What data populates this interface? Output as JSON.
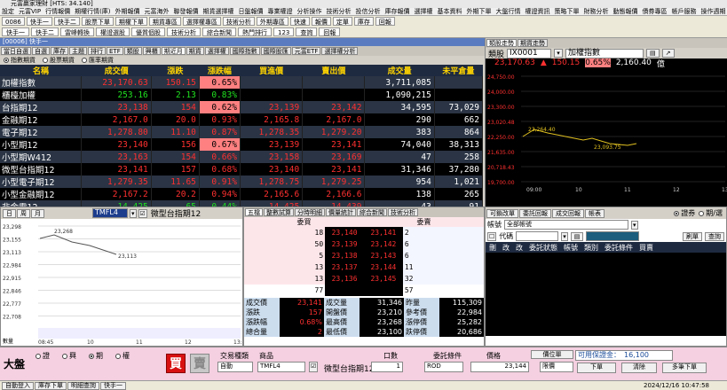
{
  "app": {
    "title": "元富贏家理財 [HTS: 34.140]",
    "window_sub": "[00006] 快手一"
  },
  "menu": [
    "設定",
    "元富VIP",
    "行情報價",
    "期權行情(庫)",
    "外期報價",
    "元富海外",
    "聯發報價",
    "期貨選擇權",
    "日盤報價",
    "專業權證",
    "分析操作",
    "技術分析",
    "投信分析",
    "庫存報價",
    "選擇權",
    "基本資料",
    "外期下單",
    "大盤行情",
    "權證資訊",
    "策略下單",
    "財務分析",
    "動態報價",
    "債券專區",
    "帳戶服務",
    "操作週期"
  ],
  "toolbar1": [
    "0086",
    "快手一",
    "快手二",
    "股票下單",
    "期權下單",
    "期貨專區",
    "選擇權專區",
    "技術分析",
    "外期專區",
    "快速",
    "報價",
    "定單",
    "庫存",
    "回報"
  ],
  "toolbar2": [
    "快手一",
    "快手二",
    "雷峰轉換",
    "權證選股",
    "優質個股",
    "技術分析",
    "綜合新聞",
    "熱門排行",
    "123",
    "查詢",
    "回報"
  ],
  "quote": {
    "tabs": [
      "當日自選",
      "自選",
      "庫存",
      "主題",
      "排行",
      "ETF",
      "類股",
      "興櫃",
      "期近月",
      "期貨",
      "選擇權",
      "國際指數",
      "國際股匯",
      "元富ETF",
      "選擇權分析"
    ],
    "radios": [
      "指數期貨",
      "股票期貨",
      "匯率期貨"
    ],
    "headers": [
      "名稱",
      "成交價",
      "漲跌",
      "漲跌幅",
      "買進價",
      "賣出價",
      "成交量",
      "未平倉量"
    ],
    "rows": [
      {
        "n": "加權指數",
        "p": "23,170.63",
        "c": "150.15",
        "pct": "0.65%",
        "b": "",
        "s": "",
        "v": "3,711,085",
        "oi": "",
        "pc": "r",
        "pctbg": "pk"
      },
      {
        "n": "櫃檯加權",
        "p": "253.16",
        "c": "2.13",
        "pct": "0.83%",
        "b": "",
        "s": "",
        "v": "1,090,215",
        "oi": "",
        "pc": "g",
        "pctbg": ""
      },
      {
        "n": "台指期12",
        "p": "23,138",
        "c": "154",
        "pct": "0.62%",
        "b": "23,139",
        "s": "23,142",
        "v": "34,595",
        "oi": "73,029",
        "pc": "r",
        "pctbg": "pk"
      },
      {
        "n": "金融期12",
        "p": "2,167.0",
        "c": "20.0",
        "pct": "0.93%",
        "b": "2,165.8",
        "s": "2,167.0",
        "v": "290",
        "oi": "662",
        "pc": "r",
        "pctbg": ""
      },
      {
        "n": "電子期12",
        "p": "1,278.80",
        "c": "11.10",
        "pct": "0.87%",
        "b": "1,278.35",
        "s": "1,279.20",
        "v": "383",
        "oi": "864",
        "pc": "r",
        "pctbg": ""
      },
      {
        "n": "小型期12",
        "p": "23,140",
        "c": "156",
        "pct": "0.67%",
        "b": "23,139",
        "s": "23,141",
        "v": "74,040",
        "oi": "38,313",
        "pc": "r",
        "pctbg": "pk"
      },
      {
        "n": "小型期W412",
        "p": "23,163",
        "c": "154",
        "pct": "0.66%",
        "b": "23,158",
        "s": "23,169",
        "v": "47",
        "oi": "258",
        "pc": "r",
        "pctbg": ""
      },
      {
        "n": "微型台指期12",
        "p": "23,141",
        "c": "157",
        "pct": "0.68%",
        "b": "23,140",
        "s": "23,141",
        "v": "31,346",
        "oi": "37,280",
        "pc": "r",
        "pctbg": ""
      },
      {
        "n": "小型電子期12",
        "p": "1,279.35",
        "c": "11.65",
        "pct": "0.91%",
        "b": "1,278.75",
        "s": "1,279.25",
        "v": "954",
        "oi": "1,021",
        "pc": "r",
        "pctbg": ""
      },
      {
        "n": "小型金融期12",
        "p": "2,167.2",
        "c": "20.2",
        "pct": "0.94%",
        "b": "2,165.6",
        "s": "2,166.6",
        "v": "138",
        "oi": "265",
        "pc": "r",
        "pctbg": ""
      },
      {
        "n": "非金電12",
        "p": "14,425",
        "c": "65",
        "pct": "0.44%",
        "b": "14,425",
        "s": "14,439",
        "v": "43",
        "oi": "91",
        "pc": "g",
        "pctbg": ""
      }
    ]
  },
  "index_panel": {
    "tabs": [
      "類股走勢",
      "期貨走勢"
    ],
    "label": "類股",
    "code": "IX0001",
    "name": "加權指數",
    "price": "23,170.63",
    "change": "150.15",
    "pct": "0.65%",
    "vol": "2,160.40",
    "unit": "億",
    "prices": [
      "24,750.00",
      "24,000.00",
      "23,300.00",
      "23,020.48",
      "22,250.00",
      "21,635.00",
      "20,718.43",
      "19,700.00"
    ],
    "ann_hi": "23,264.40",
    "ann_lo": "23,093.75",
    "times": [
      "09:00",
      "10",
      "11",
      "12",
      "13"
    ]
  },
  "mini_chart": {
    "tabs": [
      "日",
      "周",
      "月"
    ],
    "code": "TMFL4",
    "name": "微型台指期12",
    "prices": [
      "23,298",
      "23,155",
      "23,113",
      "22,984",
      "22,915",
      "22,846",
      "22,777",
      "22,708"
    ],
    "ann_hi": "23,268",
    "ann_lo": "23,113",
    "times": [
      "08:45",
      "10",
      "11",
      "12",
      "13:45"
    ],
    "vol_label": "數量"
  },
  "orderbook": {
    "tabs": [
      "五檔",
      "整數試算",
      "分時明細",
      "價量統計",
      "綜合新聞",
      "技術分析"
    ],
    "buy_hdr": "委買",
    "sell_hdr": "委賣",
    "rows": [
      {
        "bq": "18",
        "bp": "23,140",
        "sp": "23,141",
        "sq": "2"
      },
      {
        "bq": "50",
        "bp": "23,139",
        "sp": "23,142",
        "sq": "6"
      },
      {
        "bq": "5",
        "bp": "23,138",
        "sp": "23,143",
        "sq": "6"
      },
      {
        "bq": "13",
        "bp": "23,137",
        "sp": "23,144",
        "sq": "11"
      },
      {
        "bq": "13",
        "bp": "23,136",
        "sp": "23,145",
        "sq": "32"
      }
    ],
    "total_b": "77",
    "total_s": "57",
    "stats": [
      [
        "成交價",
        "23,141",
        "成交量",
        "31,346",
        "昨量",
        "115,309"
      ],
      [
        "漲跌",
        "157",
        "開盤價",
        "23,210",
        "參考價",
        "22,984"
      ],
      [
        "漲跌幅",
        "0.68%",
        "最高價",
        "23,268",
        "漲停價",
        "25,282"
      ],
      [
        "總合量",
        "2",
        "最低價",
        "23,100",
        "跌停價",
        "20,686"
      ]
    ]
  },
  "orders": {
    "tabs": [
      "可鎖改單",
      "委託回報",
      "成交回報",
      "帳表"
    ],
    "radios": [
      "證券",
      "期/選"
    ],
    "account_label": "帳號",
    "account": "全部帳號",
    "code_label": "代碼",
    "btn1": "刷單",
    "btn2": "查詢",
    "cols": [
      "刪",
      "改",
      "改",
      "委託狀態",
      "帳號",
      "類別",
      "委託條件",
      "買賣"
    ]
  },
  "entry": {
    "label": "大盤",
    "markets": [
      "證",
      "興",
      "期",
      "權"
    ],
    "buy": "買",
    "sell": "賣",
    "fields": {
      "type_label": "交易種類",
      "type": "自動",
      "item_label": "商品",
      "code": "TMFL4",
      "name": "微型台指期12",
      "lot_label": "口數",
      "lot": "1",
      "cond_label": "委託條件",
      "cond": "ROD",
      "price_label": "價格",
      "price": "23,144",
      "mode": "限價"
    },
    "btn_order": "下單",
    "btn_clear": "清除",
    "btn_multi": "多筆下單",
    "btn_pos": "價位單",
    "margin": "可用保證金：",
    "margin_val": "16,100"
  },
  "status": {
    "tabs": [
      "自動登入",
      "庫存下單",
      "明細查詢",
      "快手一"
    ],
    "datetime": "2024/12/16 10:47:58"
  }
}
